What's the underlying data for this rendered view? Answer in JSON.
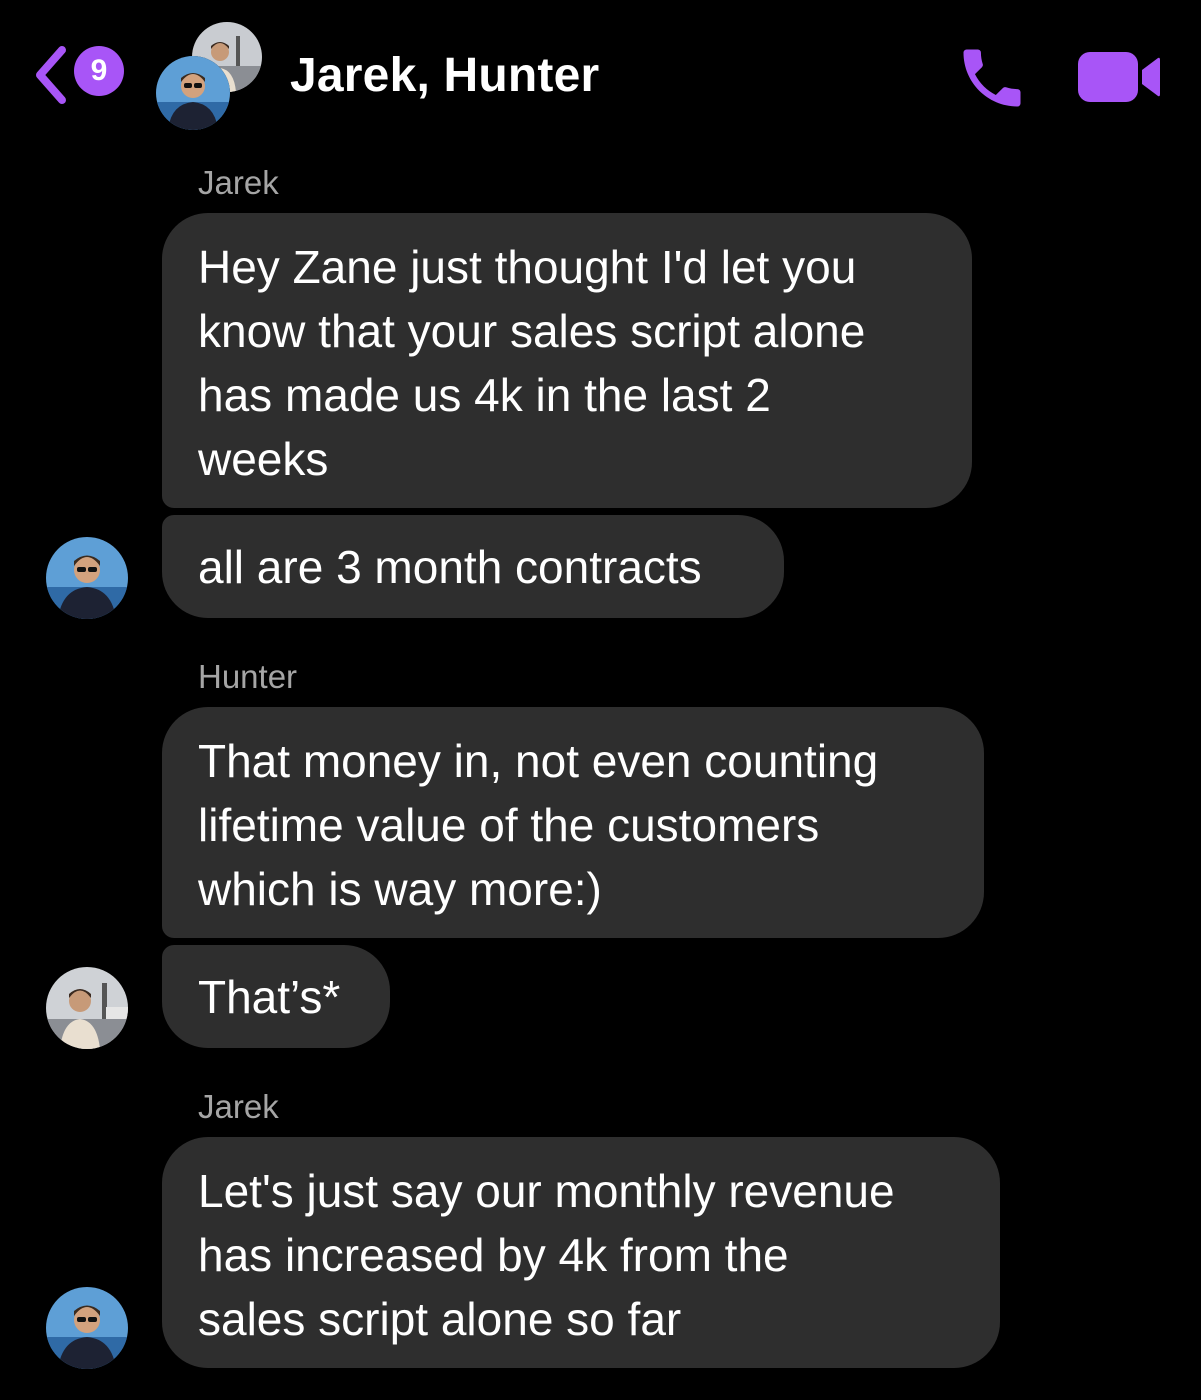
{
  "header": {
    "unread_count": "9",
    "title": "Jarek, Hunter",
    "accent_color": "#a855f7"
  },
  "messages": [
    {
      "sender": "Jarek",
      "bubbles": [
        {
          "lines": [
            "Hey Zane just thought I'd let you",
            "know that your sales script alone",
            "has made us 4k in the last 2",
            "weeks"
          ]
        },
        {
          "lines": [
            "all are 3 month contracts"
          ]
        }
      ]
    },
    {
      "sender": "Hunter",
      "bubbles": [
        {
          "lines": [
            "That money in, not even counting",
            "lifetime value of the customers",
            "which is way more:)"
          ]
        },
        {
          "lines": [
            "That’s*"
          ]
        }
      ]
    },
    {
      "sender": "Jarek",
      "bubbles": [
        {
          "lines": [
            "Let's just say our monthly revenue",
            "has increased by 4k from the",
            "sales script alone so far"
          ]
        }
      ]
    }
  ],
  "icons": {
    "back": "chevron-left-icon",
    "call": "phone-icon",
    "video": "video-camera-icon"
  }
}
